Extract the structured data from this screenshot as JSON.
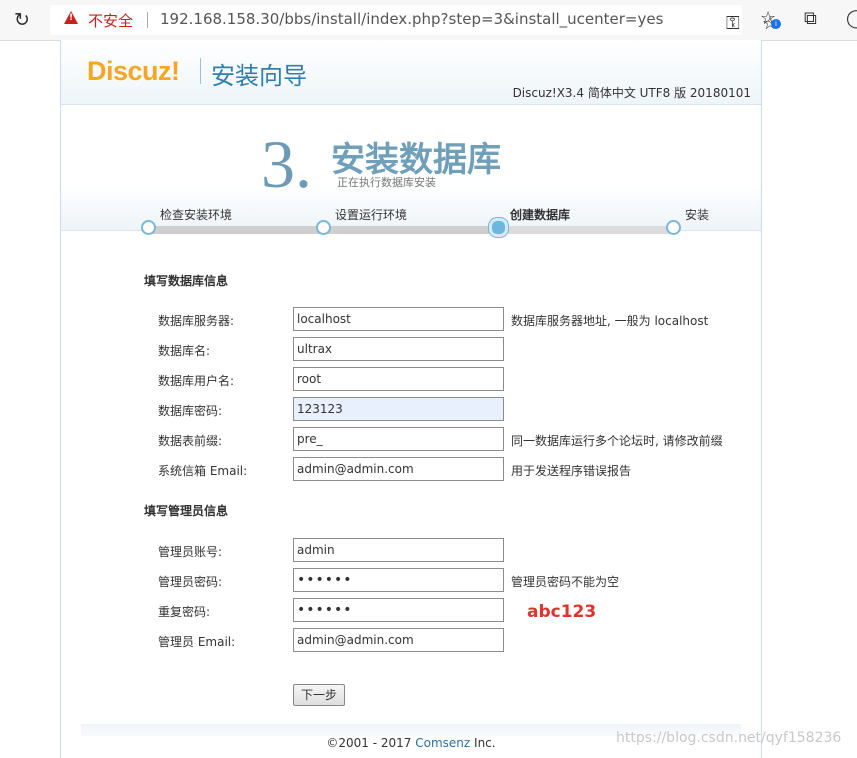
{
  "browser": {
    "security_label": "不安全",
    "url": "192.168.158.30/bbs/install/index.php?step=3&install_ucenter=yes"
  },
  "header": {
    "logo": "Discuz!",
    "subtitle": "安装向导",
    "version": "Discuz!X3.4 简体中文 UTF8 版 20180101"
  },
  "step": {
    "number": "3.",
    "title": "安装数据库",
    "subtitle": "正在执行数据库安装",
    "items": [
      {
        "label": "检查安装环境"
      },
      {
        "label": "设置运行环境"
      },
      {
        "label": "创建数据库"
      },
      {
        "label": "安装"
      }
    ],
    "current_index": 2
  },
  "db_section": {
    "title": "填写数据库信息",
    "fields": [
      {
        "label": "数据库服务器:",
        "value": "localhost",
        "hint": "数据库服务器地址, 一般为 localhost"
      },
      {
        "label": "数据库名:",
        "value": "ultrax",
        "hint": ""
      },
      {
        "label": "数据库用户名:",
        "value": "root",
        "hint": ""
      },
      {
        "label": "数据库密码:",
        "value": "123123",
        "hint": ""
      },
      {
        "label": "数据表前缀:",
        "value": "pre_",
        "hint": "同一数据库运行多个论坛时, 请修改前缀"
      },
      {
        "label": "系统信箱 Email:",
        "value": "admin@admin.com",
        "hint": "用于发送程序错误报告"
      }
    ]
  },
  "admin_section": {
    "title": "填写管理员信息",
    "fields": [
      {
        "label": "管理员账号:",
        "value": "admin",
        "hint": ""
      },
      {
        "label": "管理员密码:",
        "value": "••••••",
        "hint": "管理员密码不能为空"
      },
      {
        "label": "重复密码:",
        "value": "••••••",
        "hint": ""
      },
      {
        "label": "管理员 Email:",
        "value": "admin@admin.com",
        "hint": ""
      }
    ]
  },
  "annotation": "abc123",
  "next_button": "下一步",
  "footer": {
    "prefix": "©2001 - 2017 ",
    "brand": "Comsenz",
    "suffix": " Inc."
  },
  "watermark": "https://blog.csdn.net/qyf158236"
}
